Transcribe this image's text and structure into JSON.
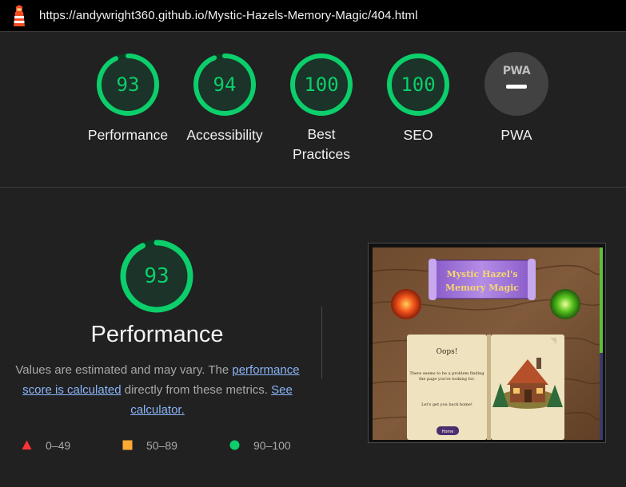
{
  "topbar": {
    "url": "https://andywright360.github.io/Mystic-Hazels-Memory-Magic/404.html",
    "logo_icon": "lighthouse-icon"
  },
  "gauges": [
    {
      "score": "93",
      "label": "Performance",
      "value": 0.93
    },
    {
      "score": "94",
      "label": "Accessibility",
      "value": 0.94
    },
    {
      "score": "100",
      "label": "Best Practices",
      "value": 1.0
    },
    {
      "score": "100",
      "label": "SEO",
      "value": 1.0
    },
    {
      "label": "PWA",
      "logo_text": "PWA",
      "icon": "pwa-icon"
    }
  ],
  "performance": {
    "score": "93",
    "value": 0.93,
    "title": "Performance",
    "desc_1": "Values are estimated and may vary. The",
    "link_1": "performance score is calculated",
    "desc_2": "directly from these metrics.",
    "link_2": "See calculator."
  },
  "legend": [
    {
      "range": "0–49",
      "icon": "triangle-icon",
      "color": "#ff3333"
    },
    {
      "range": "50–89",
      "icon": "square-icon",
      "color": "#ffaa33"
    },
    {
      "range": "90–100",
      "icon": "circle-icon",
      "color": "#0cce6b"
    }
  ],
  "screenshot": {
    "banner_line_1": "Mystic Hazel's",
    "banner_line_2": "Memory Magic",
    "heading": "Oops!",
    "message": "There seems to be a problem finding the page you're looking for.",
    "cta": "Let's get you back home!",
    "button": "Home"
  },
  "colors": {
    "pass": "#0cce6b",
    "pass_track": "#0b3a22",
    "background": "#212121",
    "link": "#8ab4f8"
  }
}
